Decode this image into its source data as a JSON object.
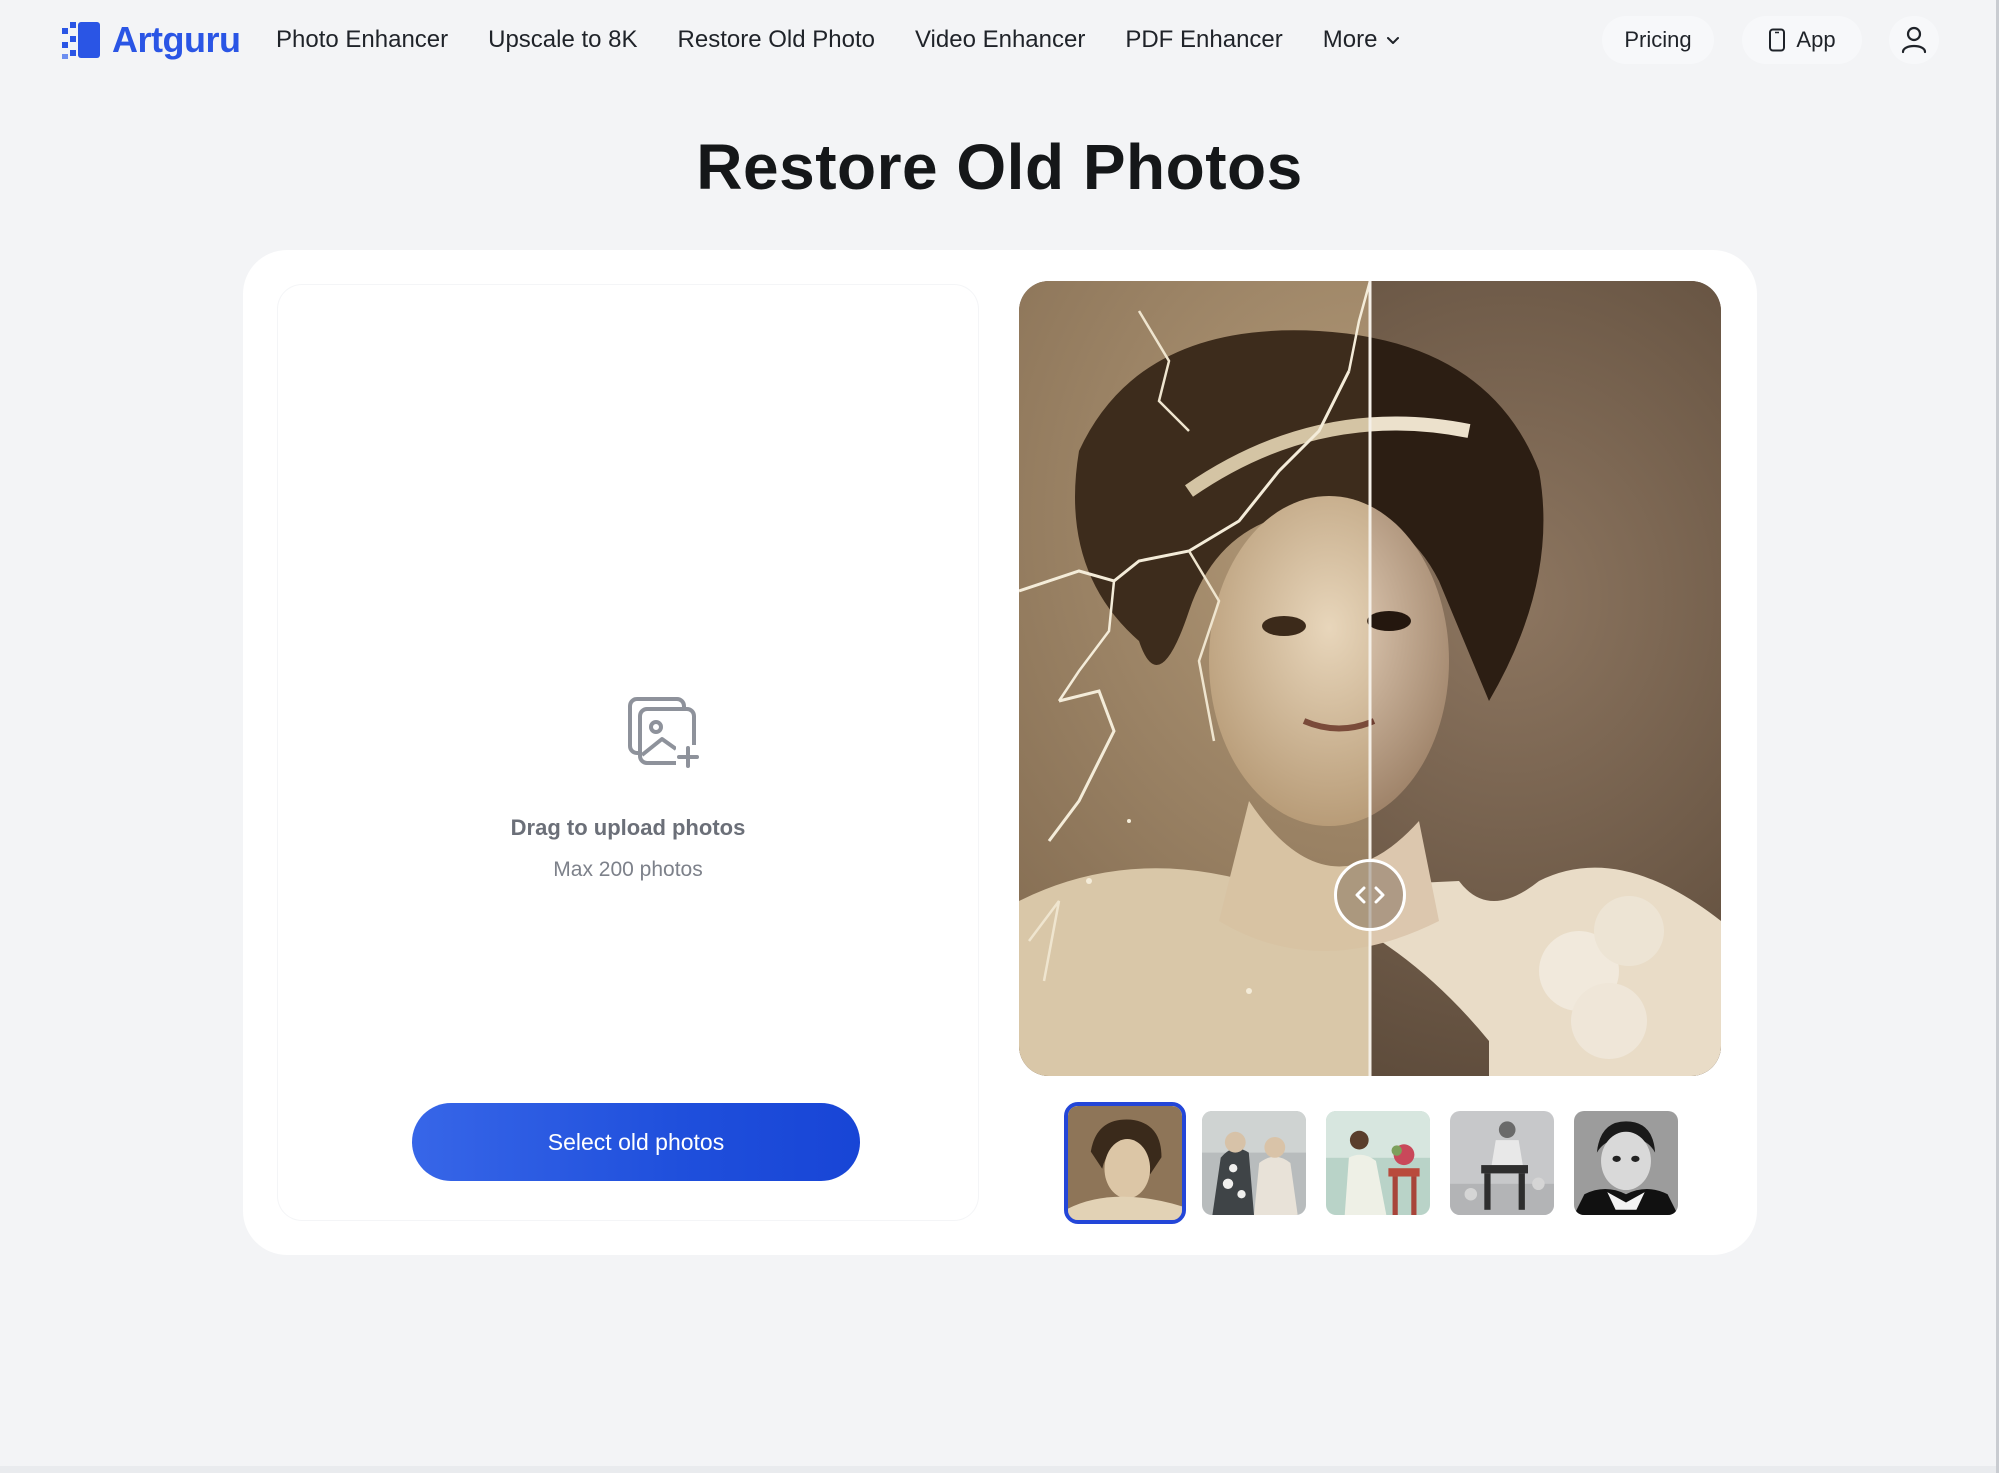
{
  "brand": {
    "name": "Artguru"
  },
  "nav": {
    "items": [
      {
        "label": "Photo Enhancer"
      },
      {
        "label": "Upscale to 8K"
      },
      {
        "label": "Restore Old Photo"
      },
      {
        "label": "Video Enhancer"
      },
      {
        "label": "PDF Enhancer"
      },
      {
        "label": "More"
      }
    ],
    "pricing": "Pricing",
    "app": "App"
  },
  "page": {
    "title": "Restore Old Photos"
  },
  "upload": {
    "title": "Drag to upload photos",
    "subtitle": "Max 200 photos",
    "button": "Select old photos"
  },
  "viewer": {
    "slider_position": 0.5,
    "selected_sample": 0
  },
  "samples": [
    {
      "icon": "woman-portrait-sepia"
    },
    {
      "icon": "couple-floral-photo"
    },
    {
      "icon": "woman-seated-color"
    },
    {
      "icon": "child-on-stool"
    },
    {
      "icon": "boy-portrait-bw"
    }
  ],
  "colors": {
    "brand": "#2a55e5",
    "button": "#1f4fdc",
    "active_thumb_border": "#2346d8",
    "background": "#f3f4f6"
  }
}
